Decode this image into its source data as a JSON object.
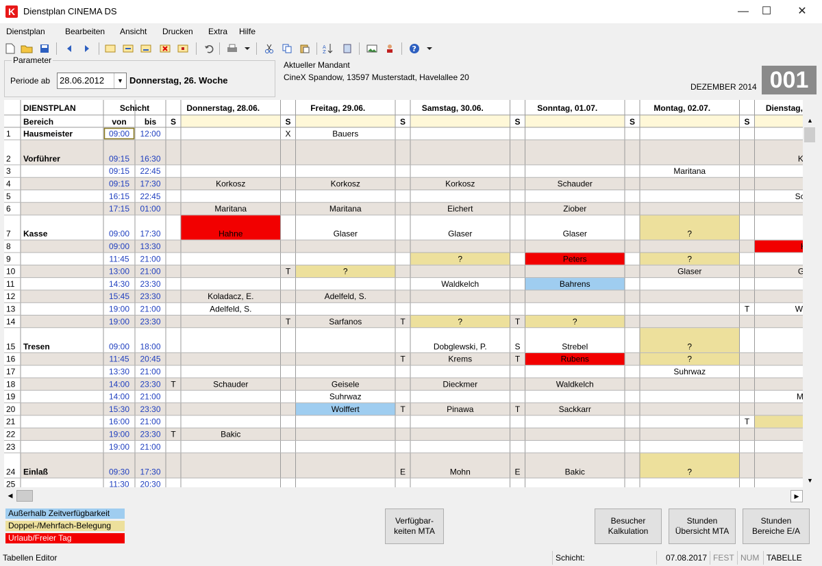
{
  "window": {
    "title": "Dienstplan CINEMA DS",
    "logo_letter": "K"
  },
  "menu": [
    "Dienstplan",
    "Bearbeiten",
    "Ansicht",
    "Drucken",
    "Extra",
    "Hilfe"
  ],
  "toolbar_icons": [
    "new-icon",
    "open-icon",
    "save-icon",
    "back-icon",
    "forward-icon",
    "insert-row-icon",
    "import-icon",
    "export-icon",
    "delete-icon",
    "edit-icon",
    "undo-icon",
    "print-icon",
    "print-dropdown-icon",
    "cut-icon",
    "copy-icon",
    "paste-icon",
    "sort-icon",
    "list-icon",
    "image-icon",
    "user-icon",
    "help-icon",
    "help-dropdown-icon"
  ],
  "parameter": {
    "legend": "Parameter",
    "periode_label": "Periode ab",
    "date": "28.06.2012",
    "weekday": "Donnerstag, 26. Woche"
  },
  "mandant": {
    "label": "Aktueller Mandant",
    "value": "CineX Spandow, 13597 Musterstadt, Havelallee 20"
  },
  "month_label": "DEZEMBER 2014",
  "big_number": "001",
  "grid": {
    "title": "DIENSTPLAN",
    "schicht": "Schicht",
    "bereich": "Bereich",
    "von": "von",
    "bis": "bis",
    "s": "S",
    "days": [
      "Donnerstag, 28.06.",
      "Freitag, 29.06.",
      "Samstag, 30.06.",
      "Sonntag, 01.07.",
      "Montag, 02.07.",
      "Dienstag, 03.07."
    ],
    "rows": [
      {
        "n": "1",
        "bereich": "Hausmeister",
        "von": "09:00",
        "bis": "12:00",
        "tall": false,
        "cells": [
          [
            "",
            ""
          ],
          [
            "X",
            "Bauers"
          ],
          [
            "",
            ""
          ],
          [
            "",
            ""
          ],
          [
            "",
            ""
          ],
          [
            "",
            ""
          ]
        ]
      },
      {
        "n": "2",
        "bereich": "Vorführer",
        "von": "09:15",
        "bis": "16:30",
        "tall": true,
        "cells": [
          [
            "",
            ""
          ],
          [
            "",
            ""
          ],
          [
            "",
            ""
          ],
          [
            "",
            ""
          ],
          [
            "",
            ""
          ],
          [
            "",
            "Kre"
          ]
        ]
      },
      {
        "n": "3",
        "bereich": "",
        "von": "09:15",
        "bis": "22:45",
        "tall": false,
        "cells": [
          [
            "",
            ""
          ],
          [
            "",
            ""
          ],
          [
            "",
            ""
          ],
          [
            "",
            ""
          ],
          [
            "",
            "Maritana"
          ],
          [
            "",
            ""
          ]
        ]
      },
      {
        "n": "4",
        "bereich": "",
        "von": "09:15",
        "bis": "17:30",
        "tall": false,
        "cells": [
          [
            "",
            "Korkosz"
          ],
          [
            "",
            "Korkosz"
          ],
          [
            "",
            "Korkosz"
          ],
          [
            "",
            "Schauder"
          ],
          [
            "",
            ""
          ],
          [
            "",
            ""
          ]
        ]
      },
      {
        "n": "5",
        "bereich": "",
        "von": "16:15",
        "bis": "22:45",
        "tall": false,
        "cells": [
          [
            "",
            ""
          ],
          [
            "",
            ""
          ],
          [
            "",
            ""
          ],
          [
            "",
            ""
          ],
          [
            "",
            ""
          ],
          [
            "",
            "Scha"
          ]
        ]
      },
      {
        "n": "6",
        "bereich": "",
        "von": "17:15",
        "bis": "01:00",
        "tall": false,
        "cells": [
          [
            "",
            "Maritana"
          ],
          [
            "",
            "Maritana"
          ],
          [
            "",
            "Eichert"
          ],
          [
            "",
            "Ziober"
          ],
          [
            "",
            ""
          ],
          [
            "",
            ""
          ]
        ]
      },
      {
        "n": "7",
        "bereich": "Kasse",
        "von": "09:00",
        "bis": "17:30",
        "tall": true,
        "cells": [
          [
            "",
            "Hahne",
            "red"
          ],
          [
            "",
            "Glaser"
          ],
          [
            "",
            "Glaser"
          ],
          [
            "",
            "Glaser"
          ],
          [
            "",
            "?",
            "yellow"
          ],
          [
            "",
            ""
          ]
        ]
      },
      {
        "n": "8",
        "bereich": "",
        "von": "09:00",
        "bis": "13:30",
        "tall": false,
        "cells": [
          [
            "",
            ""
          ],
          [
            "",
            ""
          ],
          [
            "",
            ""
          ],
          [
            "",
            ""
          ],
          [
            "",
            ""
          ],
          [
            "",
            "Kl",
            "red"
          ]
        ]
      },
      {
        "n": "9",
        "bereich": "",
        "von": "11:45",
        "bis": "21:00",
        "tall": false,
        "cells": [
          [
            "",
            ""
          ],
          [
            "",
            ""
          ],
          [
            "",
            "?",
            "yellow"
          ],
          [
            "",
            "Peters",
            "red"
          ],
          [
            "",
            "?",
            "yellow"
          ],
          [
            "",
            ""
          ]
        ]
      },
      {
        "n": "10",
        "bereich": "",
        "von": "13:00",
        "bis": "21:00",
        "tall": false,
        "cells": [
          [
            "",
            ""
          ],
          [
            "T",
            "?",
            "yellow"
          ],
          [
            "",
            ""
          ],
          [
            "",
            ""
          ],
          [
            "",
            "Glaser"
          ],
          [
            "",
            "Gla"
          ]
        ]
      },
      {
        "n": "11",
        "bereich": "",
        "von": "14:30",
        "bis": "23:30",
        "tall": false,
        "cells": [
          [
            "",
            ""
          ],
          [
            "",
            ""
          ],
          [
            "",
            "Waldkelch"
          ],
          [
            "",
            "Bahrens",
            "blue"
          ],
          [
            "",
            ""
          ],
          [
            "",
            ""
          ]
        ]
      },
      {
        "n": "12",
        "bereich": "",
        "von": "15:45",
        "bis": "23:30",
        "tall": false,
        "cells": [
          [
            "",
            "Koladacz, E."
          ],
          [
            "",
            "Adelfeld, S."
          ],
          [
            "",
            ""
          ],
          [
            "",
            ""
          ],
          [
            "",
            ""
          ],
          [
            "",
            ""
          ]
        ]
      },
      {
        "n": "13",
        "bereich": "",
        "von": "19:00",
        "bis": "21:00",
        "tall": false,
        "cells": [
          [
            "",
            "Adelfeld, S."
          ],
          [
            "",
            ""
          ],
          [
            "",
            ""
          ],
          [
            "",
            ""
          ],
          [
            "",
            ""
          ],
          [
            "T",
            "Wald"
          ]
        ]
      },
      {
        "n": "14",
        "bereich": "",
        "von": "19:00",
        "bis": "23:30",
        "tall": false,
        "cells": [
          [
            "",
            ""
          ],
          [
            "T",
            "Sarfanos"
          ],
          [
            "T",
            "?",
            "yellow"
          ],
          [
            "T",
            "?",
            "yellow"
          ],
          [
            "",
            ""
          ],
          [
            "",
            ""
          ]
        ]
      },
      {
        "n": "15",
        "bereich": "Tresen",
        "von": "09:00",
        "bis": "18:00",
        "tall": true,
        "cells": [
          [
            "",
            ""
          ],
          [
            "",
            ""
          ],
          [
            "",
            "Dobglewski, P."
          ],
          [
            "S",
            "Strebel"
          ],
          [
            "",
            "?",
            "yellow"
          ],
          [
            "",
            ""
          ]
        ]
      },
      {
        "n": "16",
        "bereich": "",
        "von": "11:45",
        "bis": "20:45",
        "tall": false,
        "cells": [
          [
            "",
            ""
          ],
          [
            "",
            ""
          ],
          [
            "T",
            "Krems"
          ],
          [
            "T",
            "Rubens",
            "red"
          ],
          [
            "",
            "?",
            "yellow"
          ],
          [
            "",
            ""
          ]
        ]
      },
      {
        "n": "17",
        "bereich": "",
        "von": "13:30",
        "bis": "21:00",
        "tall": false,
        "cells": [
          [
            "",
            ""
          ],
          [
            "",
            ""
          ],
          [
            "",
            ""
          ],
          [
            "",
            ""
          ],
          [
            "",
            "Suhrwaz"
          ],
          [
            "",
            ""
          ]
        ]
      },
      {
        "n": "18",
        "bereich": "",
        "von": "14:00",
        "bis": "23:30",
        "tall": false,
        "cells": [
          [
            "T",
            "Schauder"
          ],
          [
            "",
            "Geisele"
          ],
          [
            "",
            "Dieckmer"
          ],
          [
            "",
            "Waldkelch"
          ],
          [
            "",
            ""
          ],
          [
            "",
            ""
          ]
        ]
      },
      {
        "n": "19",
        "bereich": "",
        "von": "14:00",
        "bis": "21:00",
        "tall": false,
        "cells": [
          [
            "",
            ""
          ],
          [
            "",
            "Suhrwaz"
          ],
          [
            "",
            ""
          ],
          [
            "",
            ""
          ],
          [
            "",
            ""
          ],
          [
            "",
            "Mac"
          ]
        ]
      },
      {
        "n": "20",
        "bereich": "",
        "von": "15:30",
        "bis": "23:30",
        "tall": false,
        "cells": [
          [
            "",
            ""
          ],
          [
            "",
            "Wolffert",
            "blue"
          ],
          [
            "T",
            "Pinawa"
          ],
          [
            "T",
            "Sackkarr"
          ],
          [
            "",
            ""
          ],
          [
            "",
            ""
          ]
        ]
      },
      {
        "n": "21",
        "bereich": "",
        "von": "16:00",
        "bis": "21:00",
        "tall": false,
        "cells": [
          [
            "",
            ""
          ],
          [
            "",
            ""
          ],
          [
            "",
            ""
          ],
          [
            "",
            ""
          ],
          [
            "",
            ""
          ],
          [
            "T",
            "",
            "yellow"
          ]
        ]
      },
      {
        "n": "22",
        "bereich": "",
        "von": "19:00",
        "bis": "23:30",
        "tall": false,
        "cells": [
          [
            "T",
            "Bakic"
          ],
          [
            "",
            ""
          ],
          [
            "",
            ""
          ],
          [
            "",
            ""
          ],
          [
            "",
            ""
          ],
          [
            "",
            ""
          ]
        ]
      },
      {
        "n": "23",
        "bereich": "",
        "von": "19:00",
        "bis": "21:00",
        "tall": false,
        "cells": [
          [
            "",
            ""
          ],
          [
            "",
            ""
          ],
          [
            "",
            ""
          ],
          [
            "",
            ""
          ],
          [
            "",
            ""
          ],
          [
            "",
            ""
          ]
        ]
      },
      {
        "n": "24",
        "bereich": "Einlaß",
        "von": "09:30",
        "bis": "17:30",
        "tall": true,
        "cells": [
          [
            "",
            ""
          ],
          [
            "",
            ""
          ],
          [
            "E",
            "Mohn"
          ],
          [
            "E",
            "Bakic"
          ],
          [
            "",
            "?",
            "yellow"
          ],
          [
            "",
            ""
          ]
        ]
      },
      {
        "n": "25",
        "bereich": "",
        "von": "11:30",
        "bis": "20:30",
        "tall": false,
        "cells": [
          [
            "",
            ""
          ],
          [
            "",
            ""
          ],
          [
            "",
            ""
          ],
          [
            "",
            ""
          ],
          [
            "",
            ""
          ],
          [
            "",
            ""
          ]
        ]
      }
    ]
  },
  "legend": [
    {
      "label": "Außerhalb Zeitverfügbarkeit",
      "color": "#9fcdf0",
      "text": "#000000"
    },
    {
      "label": "Doppel-/Mehrfach-Belegung",
      "color": "#ede09c",
      "text": "#000000"
    },
    {
      "label": "Urlaub/Freier Tag",
      "color": "#f20000",
      "text": "#ffffff"
    }
  ],
  "buttons": {
    "verfuegbarkeiten": "Verfügbar-\nkeiten MTA",
    "besucher": "Besucher\nKalkulation",
    "stunden_mta": "Stunden\nÜbersicht MTA",
    "stunden_bereiche": "Stunden\nBereiche E/A"
  },
  "status": {
    "editor": "Tabellen Editor",
    "schicht": "Schicht:",
    "date": "07.08.2017",
    "fest": "FEST",
    "num": "NUM",
    "tabelle": "TABELLE"
  },
  "colors": {
    "red": "#f20000",
    "yellow": "#ede09c",
    "blue": "#9fcdf0",
    "shade": "#e8e2dc",
    "time": "#1f3fbf",
    "header_bg": "#fff8d8"
  }
}
